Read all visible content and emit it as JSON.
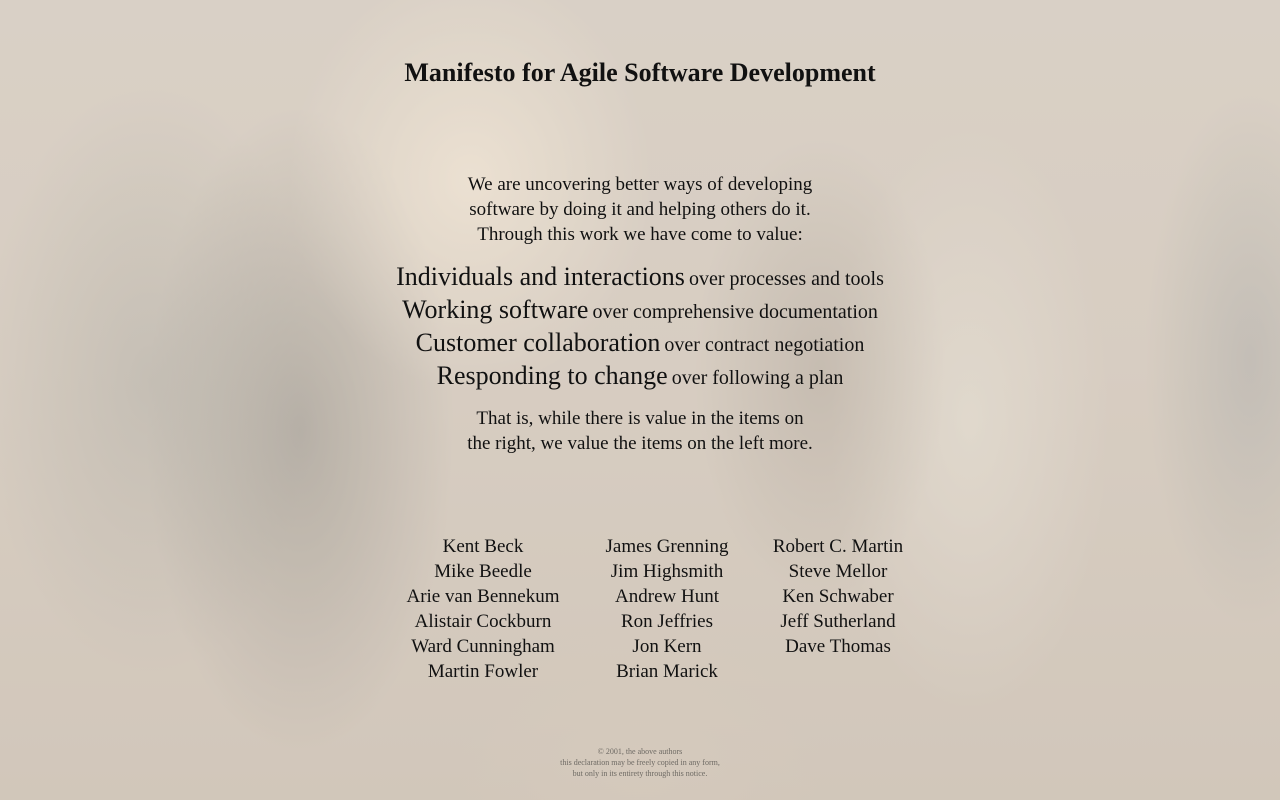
{
  "title": "Manifesto for Agile Software Development",
  "intro": [
    "We are uncovering better ways of developing",
    "software by doing it and helping others do it.",
    "Through this work we have come to value:"
  ],
  "values": [
    {
      "left": "Individuals and interactions",
      "right": "over processes and tools"
    },
    {
      "left": "Working software",
      "right": "over comprehensive documentation"
    },
    {
      "left": "Customer collaboration",
      "right": "over contract negotiation"
    },
    {
      "left": "Responding to change",
      "right": "over following a plan"
    }
  ],
  "conclusion": [
    "That is, while there is value in the items on",
    "the right, we value the items on the left more."
  ],
  "authors": {
    "col1": [
      "Kent Beck",
      "Mike Beedle",
      "Arie van Bennekum",
      "Alistair Cockburn",
      "Ward Cunningham",
      "Martin Fowler"
    ],
    "col2": [
      "James Grenning",
      "Jim Highsmith",
      "Andrew Hunt",
      "Ron Jeffries",
      "Jon Kern",
      "Brian Marick"
    ],
    "col3": [
      "Robert C. Martin",
      "Steve Mellor",
      "Ken Schwaber",
      "Jeff Sutherland",
      "Dave Thomas"
    ]
  },
  "copyright": [
    "© 2001, the above authors",
    "this declaration may be freely copied in any form,",
    "but only in its entirety through this notice."
  ],
  "colors": {
    "text": "#111111",
    "copyright_text": "#6e6a64",
    "background": "#c8bcad"
  }
}
